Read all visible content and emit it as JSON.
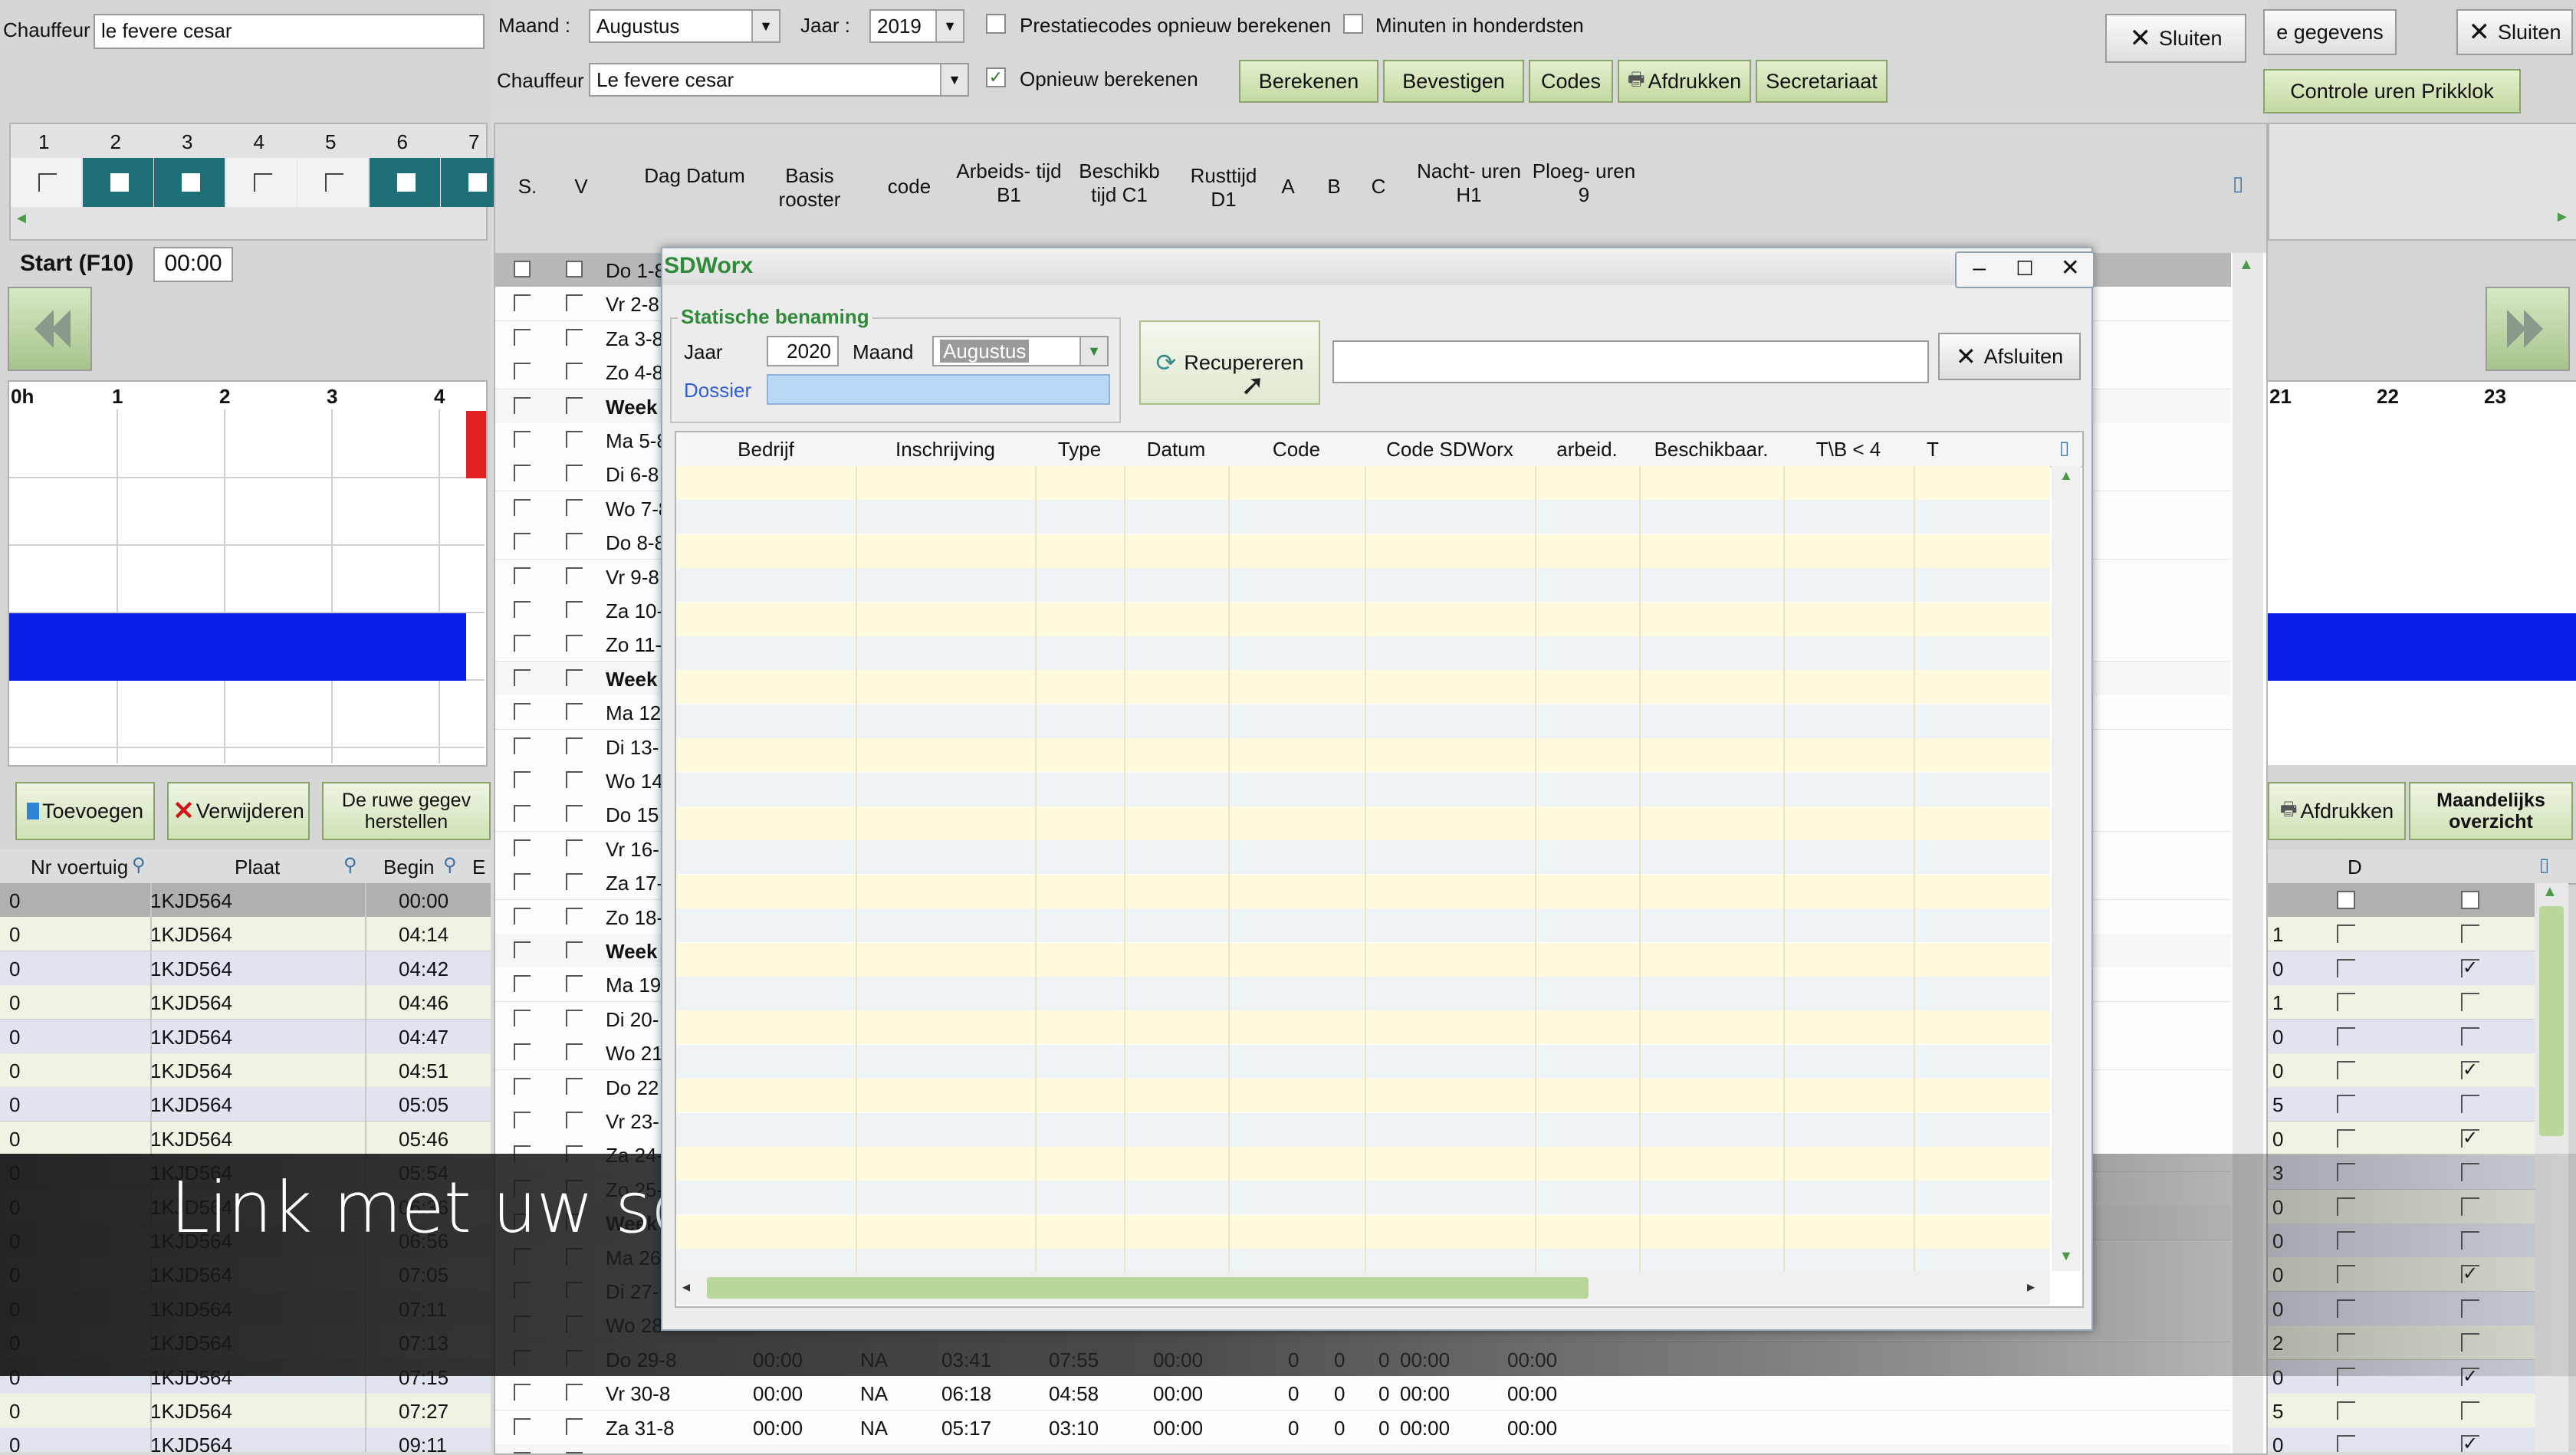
{
  "left_panel": {
    "chauffeur_label": "Chauffeur",
    "chauffeur_value": "le fevere cesar",
    "day_numbers": [
      "1",
      "2",
      "3",
      "4",
      "5",
      "6",
      "7"
    ],
    "start_label": "Start (F10)",
    "start_value": "00:00",
    "hour_labels": [
      "0h",
      "1",
      "2",
      "3",
      "4"
    ],
    "buttons": {
      "add": "Toevoegen",
      "remove": "Verwijderen",
      "restore": "De ruwe gegev herstellen"
    },
    "table_headers": {
      "nr": "Nr voertuig",
      "plaat": "Plaat",
      "begin": "Begin",
      "e": "E"
    },
    "rows": [
      {
        "nr": "0",
        "plaat": "1KJD564",
        "begin": "00:00"
      },
      {
        "nr": "0",
        "plaat": "1KJD564",
        "begin": "04:14"
      },
      {
        "nr": "0",
        "plaat": "1KJD564",
        "begin": "04:42"
      },
      {
        "nr": "0",
        "plaat": "1KJD564",
        "begin": "04:46"
      },
      {
        "nr": "0",
        "plaat": "1KJD564",
        "begin": "04:47"
      },
      {
        "nr": "0",
        "plaat": "1KJD564",
        "begin": "04:51"
      },
      {
        "nr": "0",
        "plaat": "1KJD564",
        "begin": "05:05"
      },
      {
        "nr": "0",
        "plaat": "1KJD564",
        "begin": "05:46"
      },
      {
        "nr": "0",
        "plaat": "1KJD564",
        "begin": "05:54"
      },
      {
        "nr": "0",
        "plaat": "1KJD564",
        "begin": "06:36"
      },
      {
        "nr": "0",
        "plaat": "1KJD564",
        "begin": "06:56"
      },
      {
        "nr": "0",
        "plaat": "1KJD564",
        "begin": "07:05"
      },
      {
        "nr": "0",
        "plaat": "1KJD564",
        "begin": "07:11"
      },
      {
        "nr": "0",
        "plaat": "1KJD564",
        "begin": "07:13"
      },
      {
        "nr": "0",
        "plaat": "1KJD564",
        "begin": "07:15"
      },
      {
        "nr": "0",
        "plaat": "1KJD564",
        "begin": "07:27"
      },
      {
        "nr": "0",
        "plaat": "1KJD564",
        "begin": "09:11"
      }
    ]
  },
  "top_bar": {
    "maand_label": "Maand :",
    "maand_value": "Augustus",
    "jaar_label": "Jaar :",
    "jaar_value": "2019",
    "prestatie_label": "Prestatiecodes opnieuw berekenen",
    "minuten_label": "Minuten in honderdsten",
    "chauffeur_label": "Chauffeur",
    "chauffeur_value": "Le fevere cesar",
    "opnieuw_label": "Opnieuw berekenen",
    "buttons": [
      "Berekenen",
      "Bevestigen",
      "Codes",
      "Afdrukken",
      "Secretariaat"
    ],
    "sluiten": "Sluiten"
  },
  "main_grid": {
    "headers": [
      "S.",
      "V",
      "Dag Datum",
      "Basis rooster",
      "code",
      "Arbeids- tijd B1",
      "Beschikb tijd C1",
      "Rusttijd D1",
      "A",
      "B",
      "C",
      "Nacht- uren H1",
      "Ploeg- uren 9"
    ],
    "day_rows": [
      "Do 1-8",
      "Vr 2-8",
      "Za 3-8",
      "Zo 4-8",
      "Week",
      "Ma 5-8",
      "Di 6-8",
      "Wo 7-8",
      "Do 8-8",
      "Vr 9-8",
      "Za 10-",
      "Zo 11-",
      "Week",
      "Ma 12",
      "Di 13-",
      "Wo 14",
      "Do 15",
      "Vr 16-",
      "Za 17-",
      "Zo 18-",
      "Week",
      "Ma 19",
      "Di 20-",
      "Wo 21",
      "Do 22",
      "Vr 23-",
      "Za 24-",
      "Zo 25-",
      "Week",
      "Ma 26",
      "Di 27-",
      "Wo 28",
      "Do 29-8",
      "Vr 30-8",
      "Za 31-8",
      "Week"
    ],
    "bottom_rows": [
      {
        "dag": "Do 29-8",
        "basis": "00:00",
        "code": "NA",
        "arb": "03:41",
        "besch": "07:55",
        "rust": "00:00",
        "a": "0",
        "b": "0",
        "c": "0",
        "nacht": "00:00",
        "ploeg": "00:00"
      },
      {
        "dag": "Vr 30-8",
        "basis": "00:00",
        "code": "NA",
        "arb": "06:18",
        "besch": "04:58",
        "rust": "00:00",
        "a": "0",
        "b": "0",
        "c": "0",
        "nacht": "00:00",
        "ploeg": "00:00"
      },
      {
        "dag": "Za 31-8",
        "basis": "00:00",
        "code": "NA",
        "arb": "05:17",
        "besch": "03:10",
        "rust": "00:00",
        "a": "0",
        "b": "0",
        "c": "0",
        "nacht": "00:00",
        "ploeg": "00:00"
      }
    ]
  },
  "right_panel": {
    "gegevens": "e gegevens",
    "sluiten": "Sluiten",
    "controle": "Controle uren Prikklok",
    "hour_labels": [
      "21",
      "22",
      "23"
    ],
    "afdrukken": "Afdrukken",
    "maandelijks": "Maandelijks overzicht",
    "col_d": "D",
    "num_col": [
      "1",
      "0",
      "1",
      "0",
      "0",
      "5",
      "0",
      "3",
      "0",
      "0",
      "0",
      "0",
      "2",
      "0",
      "5",
      "0"
    ],
    "check_col": [
      false,
      true,
      false,
      false,
      true,
      false,
      true,
      false,
      false,
      false,
      true,
      false,
      false,
      true,
      false,
      true
    ]
  },
  "dialog": {
    "title": "SDWorx",
    "group_label": "Statische benaming",
    "jaar_label": "Jaar",
    "jaar_value": "2020",
    "maand_label": "Maand",
    "maand_value": "Augustus",
    "dossier_label": "Dossier",
    "dossier_value": "",
    "recuperen_label": "Recupereren",
    "search_value": "",
    "afsluiten_label": "Afsluiten",
    "columns": [
      "Bedrijf",
      "Inschrijving",
      "Type",
      "Datum",
      "Code",
      "Code SDWorx",
      "arbeid.",
      "Beschikbaar.",
      "T\\B < 4",
      "T"
    ]
  },
  "caption": "Link met uw sociaal secretariaat",
  "colors": {
    "teal": "#1e6f78",
    "blue": "#0a1ee6",
    "red": "#e02020",
    "yellow_row": "#fff9dd",
    "blue_row": "#dfe8f3",
    "dossier_bg": "#b9d8f5",
    "green_btn": "#c3d9a1"
  }
}
